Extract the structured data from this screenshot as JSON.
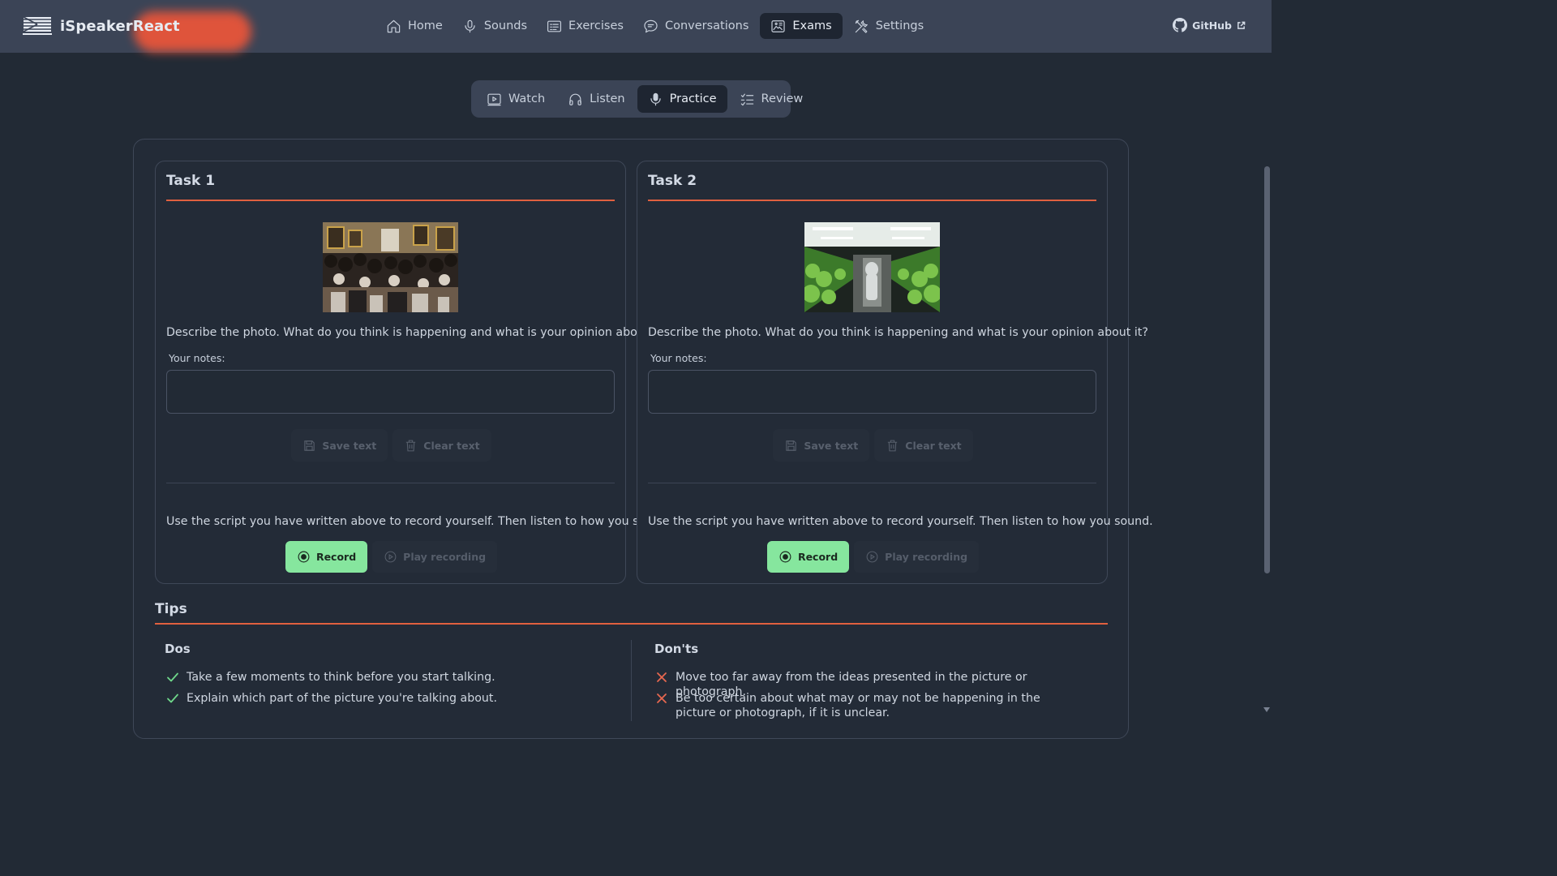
{
  "app": {
    "brand": "iSpeakerReact"
  },
  "nav": {
    "items": [
      {
        "label": "Home",
        "icon": "home-icon"
      },
      {
        "label": "Sounds",
        "icon": "microphone-icon"
      },
      {
        "label": "Exercises",
        "icon": "list-card-icon"
      },
      {
        "label": "Conversations",
        "icon": "chat-bubble-icon"
      },
      {
        "label": "Exams",
        "icon": "image-card-icon",
        "active": true
      },
      {
        "label": "Settings",
        "icon": "tools-icon"
      }
    ],
    "github_label": "GitHub"
  },
  "subtabs": [
    {
      "label": "Watch",
      "icon": "video-icon"
    },
    {
      "label": "Listen",
      "icon": "headphones-icon"
    },
    {
      "label": "Practice",
      "icon": "microphone-icon",
      "active": true
    },
    {
      "label": "Review",
      "icon": "checklist-icon"
    }
  ],
  "tasks": [
    {
      "title": "Task 1",
      "photo": "museum-crowd-photo",
      "prompt": "Describe the photo. What do you think is happening and what is your opinion about it?",
      "notes_label": "Your notes:",
      "notes_value": "",
      "save_label": "Save text",
      "clear_label": "Clear text",
      "instruction": "Use the script you have written above to record yourself. Then listen to how you sound.",
      "record_label": "Record",
      "play_label": "Play recording"
    },
    {
      "title": "Task 2",
      "photo": "indoor-farm-photo",
      "prompt": "Describe the photo. What do you think is happening and what is your opinion about it?",
      "notes_label": "Your notes:",
      "notes_value": "",
      "save_label": "Save text",
      "clear_label": "Clear text",
      "instruction": "Use the script you have written above to record yourself. Then listen to how you sound.",
      "record_label": "Record",
      "play_label": "Play recording"
    }
  ],
  "tips": {
    "title": "Tips",
    "dos_title": "Dos",
    "donts_title": "Don'ts",
    "dos": [
      "Take a few moments to think before you start talking.",
      "Explain which part of the picture you're talking about."
    ],
    "donts": [
      "Move too far away from the ideas presented in the picture or photograph.",
      "Be too certain about what may or may not be happening in the picture or photograph, if it is unclear."
    ]
  },
  "colors": {
    "accent_rule": "#e0603f",
    "record_green": "#86e69e",
    "navbar_bg": "#3b4456",
    "page_bg": "#222a35"
  }
}
